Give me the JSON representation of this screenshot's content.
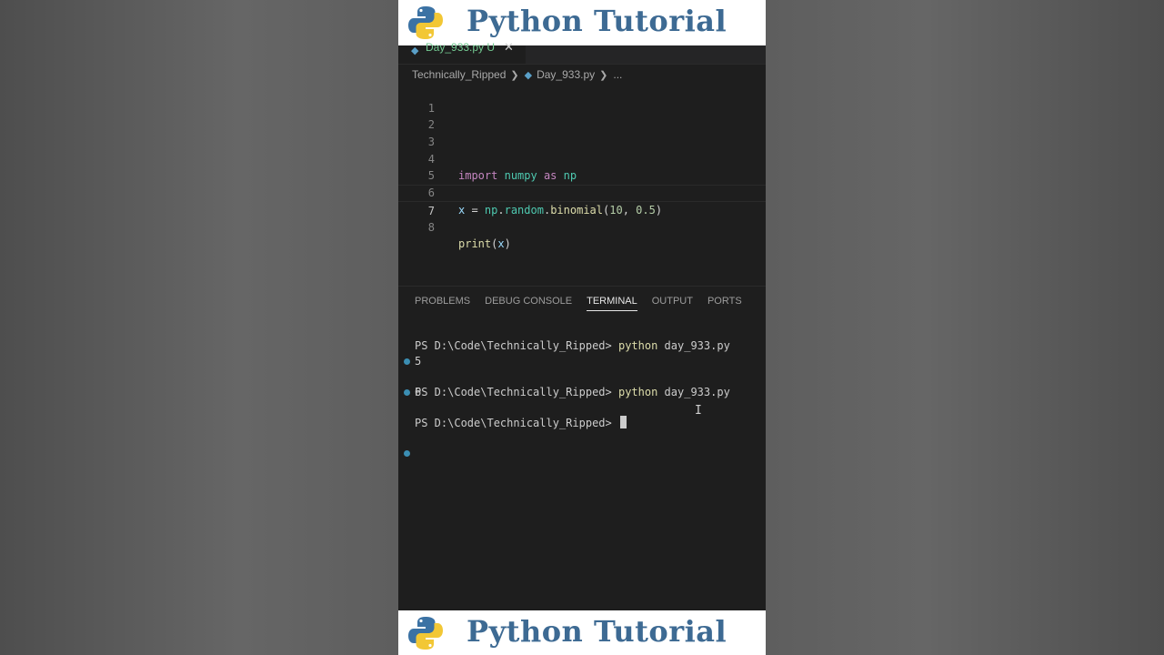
{
  "banner": {
    "title": "Python Tutorial",
    "logo_icon": "python-logo-icon"
  },
  "editor": {
    "tab": {
      "label": "Day_933.py  U",
      "icon": "python-file-icon",
      "close": "✕"
    },
    "breadcrumb": {
      "folder": "Technically_Ripped",
      "file": "Day_933.py",
      "more": "..."
    },
    "line_numbers": [
      "1",
      "2",
      "3",
      "4",
      "5",
      "6",
      "7",
      "8"
    ],
    "code": {
      "import_kw": "import",
      "module": "numpy",
      "as_kw": "as",
      "alias": "np",
      "x_var": "x",
      "eq": " = ",
      "np_ref": "np",
      "dot1": ".",
      "random_attr": "random",
      "dot2": ".",
      "binomial_fn": "binomial",
      "paren_open": "(",
      "arg1": "10",
      "comma": ", ",
      "arg2": "0.5",
      "paren_close": ")",
      "print_fn": "print",
      "print_open": "(",
      "print_arg": "x",
      "print_close": ")"
    }
  },
  "panel": {
    "tabs": [
      "PROBLEMS",
      "DEBUG CONSOLE",
      "TERMINAL",
      "OUTPUT",
      "PORTS"
    ],
    "active_tab": "TERMINAL",
    "terminal": {
      "prompt": "PS D:\\Code\\Technically_Ripped> ",
      "command": "python",
      "arg": " day_933.py",
      "output1": "5",
      "output2": "6"
    }
  },
  "colors": {
    "accent": "#3b8eb3",
    "banner_text": "#3d6a93",
    "editor_bg": "#1e1e1e"
  }
}
